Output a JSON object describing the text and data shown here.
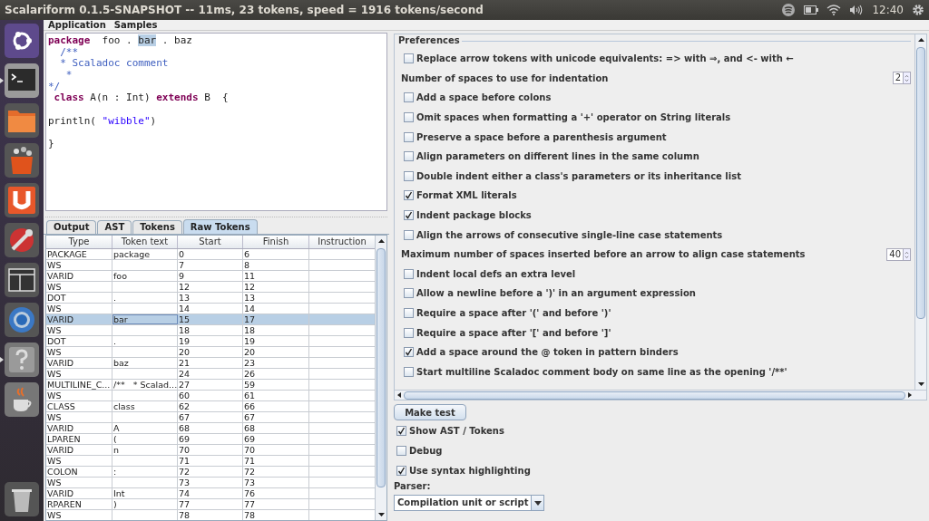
{
  "top_bar": {
    "title": "Scalariform 0.1.5-SNAPSHOT -- 11ms, 23 tokens, speed = 1916 tokens/second",
    "time": "12:40"
  },
  "menu": [
    "Application",
    "Samples"
  ],
  "editor": {
    "lines": [
      {
        "kind": "code",
        "segments": [
          {
            "text": "package",
            "kind": "keyword"
          },
          {
            "text": "  foo . ",
            "kind": "plain"
          },
          {
            "text": "bar",
            "kind": "selected"
          },
          {
            "text": " . baz",
            "kind": "plain"
          }
        ]
      },
      {
        "kind": "code",
        "segments": [
          {
            "text": "  /**",
            "kind": "comment"
          }
        ]
      },
      {
        "kind": "code",
        "segments": [
          {
            "text": "  * Scaladoc comment",
            "kind": "comment"
          }
        ]
      },
      {
        "kind": "code",
        "segments": [
          {
            "text": "   *",
            "kind": "comment"
          }
        ]
      },
      {
        "kind": "code",
        "segments": [
          {
            "text": "*/",
            "kind": "comment"
          }
        ]
      },
      {
        "kind": "code",
        "segments": [
          {
            "text": " class",
            "kind": "keyword"
          },
          {
            "text": " A(n : Int) ",
            "kind": "plain"
          },
          {
            "text": "extends",
            "kind": "keyword"
          },
          {
            "text": " B  {",
            "kind": "plain"
          }
        ]
      },
      {
        "kind": "blank"
      },
      {
        "kind": "code",
        "segments": [
          {
            "text": "println( ",
            "kind": "plain"
          },
          {
            "text": "\"wibble\"",
            "kind": "string"
          },
          {
            "text": ")",
            "kind": "plain"
          }
        ]
      },
      {
        "kind": "blank"
      },
      {
        "kind": "code",
        "segments": [
          {
            "text": "}",
            "kind": "plain"
          }
        ]
      }
    ]
  },
  "tabs": [
    {
      "label": "Output",
      "selected": false
    },
    {
      "label": "AST",
      "selected": false
    },
    {
      "label": "Tokens",
      "selected": false
    },
    {
      "label": "Raw Tokens",
      "selected": true
    }
  ],
  "table": {
    "columns": [
      "Type",
      "Token text",
      "Start",
      "Finish",
      "Instruction"
    ],
    "rows": [
      {
        "cells": [
          "PACKAGE",
          "package",
          "0",
          "6"
        ],
        "selected": false
      },
      {
        "cells": [
          "WS",
          "",
          "7",
          "8"
        ],
        "selected": false
      },
      {
        "cells": [
          "VARID",
          "foo",
          "9",
          "11"
        ],
        "selected": false
      },
      {
        "cells": [
          "WS",
          "",
          "12",
          "12"
        ],
        "selected": false
      },
      {
        "cells": [
          "DOT",
          ".",
          "13",
          "13"
        ],
        "selected": false
      },
      {
        "cells": [
          "WS",
          "",
          "14",
          "14"
        ],
        "selected": false
      },
      {
        "cells": [
          "VARID",
          "bar",
          "15",
          "17"
        ],
        "selected": true
      },
      {
        "cells": [
          "WS",
          "",
          "18",
          "18"
        ],
        "selected": false
      },
      {
        "cells": [
          "DOT",
          ".",
          "19",
          "19"
        ],
        "selected": false
      },
      {
        "cells": [
          "WS",
          "",
          "20",
          "20"
        ],
        "selected": false
      },
      {
        "cells": [
          "VARID",
          "baz",
          "21",
          "23"
        ],
        "selected": false
      },
      {
        "cells": [
          "WS",
          "",
          "24",
          "26"
        ],
        "selected": false
      },
      {
        "cells": [
          "MULTILINE_C...",
          "/**   * Scalad...",
          "27",
          "59"
        ],
        "selected": false
      },
      {
        "cells": [
          "WS",
          "",
          "60",
          "61"
        ],
        "selected": false
      },
      {
        "cells": [
          "CLASS",
          "class",
          "62",
          "66"
        ],
        "selected": false
      },
      {
        "cells": [
          "WS",
          "",
          "67",
          "67"
        ],
        "selected": false
      },
      {
        "cells": [
          "VARID",
          "A",
          "68",
          "68"
        ],
        "selected": false
      },
      {
        "cells": [
          "LPAREN",
          "(",
          "69",
          "69"
        ],
        "selected": false
      },
      {
        "cells": [
          "VARID",
          "n",
          "70",
          "70"
        ],
        "selected": false
      },
      {
        "cells": [
          "WS",
          "",
          "71",
          "71"
        ],
        "selected": false
      },
      {
        "cells": [
          "COLON",
          ":",
          "72",
          "72"
        ],
        "selected": false
      },
      {
        "cells": [
          "WS",
          "",
          "73",
          "73"
        ],
        "selected": false
      },
      {
        "cells": [
          "VARID",
          "Int",
          "74",
          "76"
        ],
        "selected": false
      },
      {
        "cells": [
          "RPAREN",
          ")",
          "77",
          "77"
        ],
        "selected": false
      },
      {
        "cells": [
          "WS",
          "",
          "78",
          "78"
        ],
        "selected": false
      }
    ]
  },
  "preferences": {
    "title": "Preferences",
    "items": [
      {
        "kind": "checkbox",
        "label": "Replace arrow tokens with unicode equivalents: => with ⇒, and <- with ←",
        "checked": false
      },
      {
        "kind": "spinner",
        "label": "Number of spaces to use for indentation",
        "value": "2"
      },
      {
        "kind": "checkbox",
        "label": "Add a space before colons",
        "checked": false
      },
      {
        "kind": "checkbox",
        "label": "Omit spaces when formatting a '+' operator on String literals",
        "checked": false
      },
      {
        "kind": "checkbox",
        "label": "Preserve a space before a parenthesis argument",
        "checked": false
      },
      {
        "kind": "checkbox",
        "label": "Align parameters on different lines in the same column",
        "checked": false
      },
      {
        "kind": "checkbox",
        "label": "Double indent either a class's parameters or its inheritance list",
        "checked": false
      },
      {
        "kind": "checkbox",
        "label": "Format XML literals",
        "checked": true
      },
      {
        "kind": "checkbox",
        "label": "Indent package blocks",
        "checked": true
      },
      {
        "kind": "checkbox",
        "label": "Align the arrows of consecutive single-line case statements",
        "checked": false
      },
      {
        "kind": "spinner",
        "label": "Maximum number of spaces inserted before an arrow to align case statements",
        "value": "40"
      },
      {
        "kind": "checkbox",
        "label": "Indent local defs an extra level",
        "checked": false
      },
      {
        "kind": "checkbox",
        "label": "Allow a newline before a ')' in an argument expression",
        "checked": false
      },
      {
        "kind": "checkbox",
        "label": "Require a space after '(' and before ')'",
        "checked": false
      },
      {
        "kind": "checkbox",
        "label": "Require a space after '[' and before ']'",
        "checked": false
      },
      {
        "kind": "checkbox",
        "label": "Add a space around the @ token in pattern binders",
        "checked": true
      },
      {
        "kind": "checkbox",
        "label": "Start multiline Scaladoc comment body on same line as the opening '/**'",
        "checked": false
      }
    ]
  },
  "make_test_button": "Make test",
  "options": [
    {
      "label": "Show AST / Tokens",
      "checked": true
    },
    {
      "label": "Debug",
      "checked": false
    },
    {
      "label": "Use syntax highlighting",
      "checked": true
    }
  ],
  "parser": {
    "label": "Parser:",
    "value": "Compilation unit or script"
  }
}
